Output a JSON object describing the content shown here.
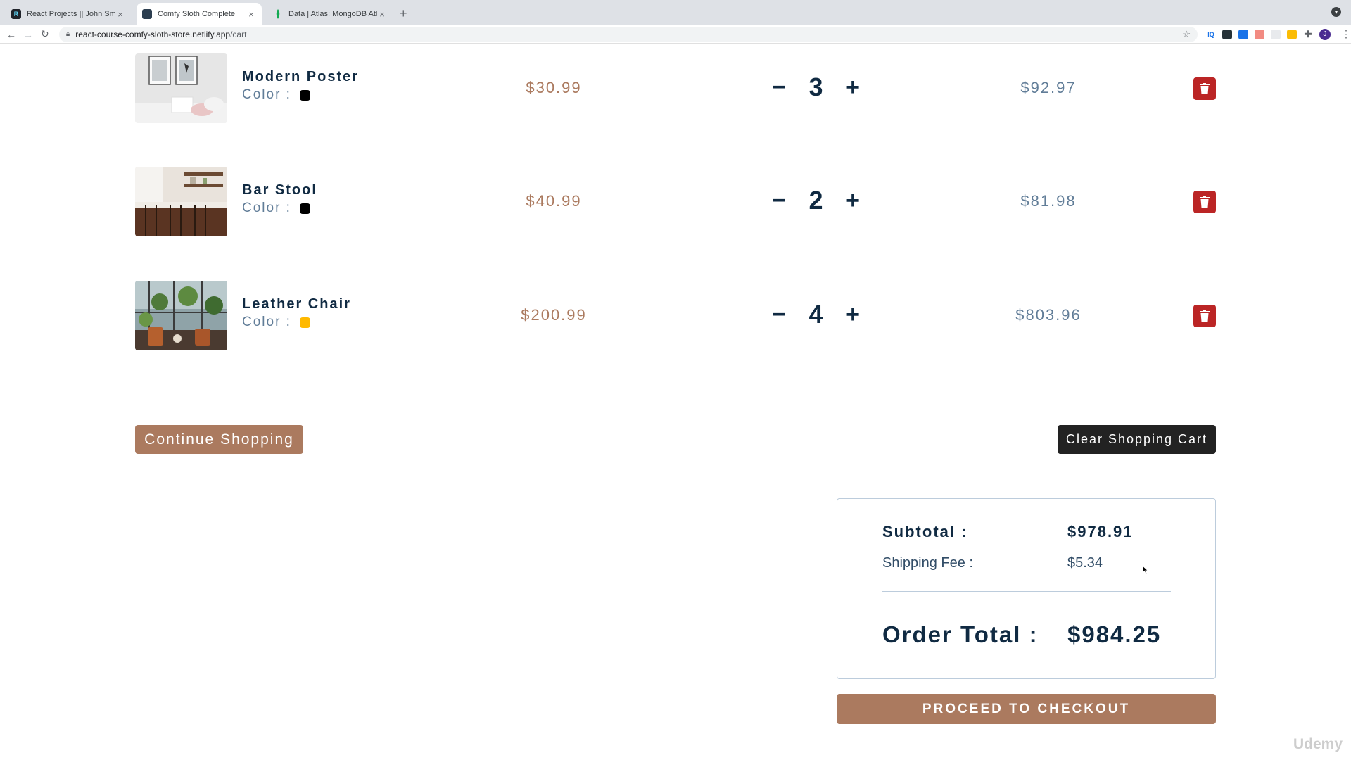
{
  "browser": {
    "tabs": [
      {
        "title": "React Projects || John Smilga",
        "favicon_text": "R",
        "favicon_color": "#61dafb",
        "active": false
      },
      {
        "title": "Comfy Sloth Complete",
        "favicon_text": "",
        "favicon_color": "#2c3e50",
        "active": true
      },
      {
        "title": "Data | Atlas: MongoDB Atlas",
        "favicon_text": "",
        "favicon_color": "#13aa52",
        "active": false
      }
    ],
    "new_tab": "+",
    "url_host": "react-course-comfy-sloth-store.netlify.app",
    "url_path": "/cart",
    "profile_initial": "J"
  },
  "cart": {
    "color_label": "Color :",
    "items": [
      {
        "name": "Modern Poster",
        "color": "#000000",
        "price": "$30.99",
        "quantity": "3",
        "subtotal": "$92.97",
        "image": "poster-room-photo"
      },
      {
        "name": "Bar Stool",
        "color": "#000000",
        "price": "$40.99",
        "quantity": "2",
        "subtotal": "$81.98",
        "image": "kitchen-bar-stools-photo"
      },
      {
        "name": "Leather Chair",
        "color": "#ffb900",
        "price": "$200.99",
        "quantity": "4",
        "subtotal": "$803.96",
        "image": "plant-cafe-chairs-photo"
      }
    ],
    "decrease_symbol": "−",
    "increase_symbol": "+",
    "continue_label": "Continue Shopping",
    "clear_label": "Clear Shopping Cart"
  },
  "totals": {
    "subtotal_label": "Subtotal :",
    "subtotal_value": "$978.91",
    "shipping_label": "Shipping Fee :",
    "shipping_value": "$5.34",
    "order_label": "Order Total :",
    "order_value": "$984.25",
    "checkout_label": "PROCEED TO CHECKOUT"
  },
  "colors": {
    "primary": "#ab7a5f",
    "dark": "#102a42",
    "danger": "#bb2525",
    "clear_button": "#222222"
  },
  "watermark": "Udemy"
}
